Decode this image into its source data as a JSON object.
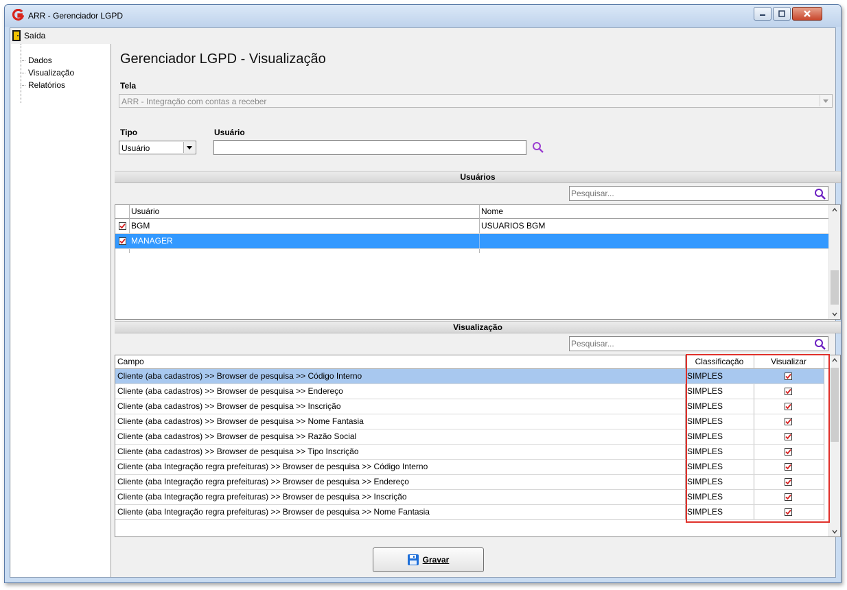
{
  "window": {
    "title": "ARR - Gerenciador LGPD"
  },
  "menu": {
    "exit_label": "Saída"
  },
  "tree": {
    "items": [
      "Dados",
      "Visualização",
      "Relatórios"
    ]
  },
  "page": {
    "title": "Gerenciador LGPD - Visualização"
  },
  "tela": {
    "label": "Tela",
    "value": "ARR - Integração com contas a receber"
  },
  "tipo": {
    "label": "Tipo",
    "value": "Usuário"
  },
  "usuario": {
    "label": "Usuário",
    "value": ""
  },
  "users_section": {
    "header": "Usuários",
    "search_placeholder": "Pesquisar...",
    "columns": [
      "Usuário",
      "Nome"
    ],
    "rows": [
      {
        "usuario": "BGM",
        "nome": "USUARIOS BGM",
        "checked": true
      },
      {
        "usuario": "MANAGER",
        "nome": "",
        "checked": true
      }
    ]
  },
  "view_section": {
    "header": "Visualização",
    "search_placeholder": "Pesquisar...",
    "columns": [
      "Campo",
      "Classificação",
      "Visualizar"
    ],
    "rows": [
      {
        "campo": "Cliente (aba cadastros) >> Browser de pesquisa >> Código Interno",
        "classificacao": "SIMPLES",
        "visualizar": true
      },
      {
        "campo": "Cliente (aba cadastros) >> Browser de pesquisa >> Endereço",
        "classificacao": "SIMPLES",
        "visualizar": true
      },
      {
        "campo": "Cliente (aba cadastros) >> Browser de pesquisa >> Inscrição",
        "classificacao": "SIMPLES",
        "visualizar": true
      },
      {
        "campo": "Cliente (aba cadastros) >> Browser de pesquisa >> Nome Fantasia",
        "classificacao": "SIMPLES",
        "visualizar": true
      },
      {
        "campo": "Cliente (aba cadastros) >> Browser de pesquisa >> Razão Social",
        "classificacao": "SIMPLES",
        "visualizar": true
      },
      {
        "campo": "Cliente (aba cadastros) >> Browser de pesquisa >> Tipo Inscrição",
        "classificacao": "SIMPLES",
        "visualizar": true
      },
      {
        "campo": "Cliente (aba Integração regra prefeituras) >> Browser de pesquisa >> Código Interno",
        "classificacao": "SIMPLES",
        "visualizar": true
      },
      {
        "campo": "Cliente (aba Integração regra prefeituras) >> Browser de pesquisa >> Endereço",
        "classificacao": "SIMPLES",
        "visualizar": true
      },
      {
        "campo": "Cliente (aba Integração regra prefeituras) >> Browser de pesquisa >> Inscrição",
        "classificacao": "SIMPLES",
        "visualizar": true
      },
      {
        "campo": "Cliente (aba Integração regra prefeituras) >> Browser de pesquisa >> Nome Fantasia",
        "classificacao": "SIMPLES",
        "visualizar": true
      }
    ]
  },
  "save_button": {
    "label": "Gravar"
  },
  "colors": {
    "selection": "#3399ff",
    "row_highlight": "#a8c8ef",
    "highlight_box": "#e0302a",
    "search_icon": "#8a2be2"
  }
}
